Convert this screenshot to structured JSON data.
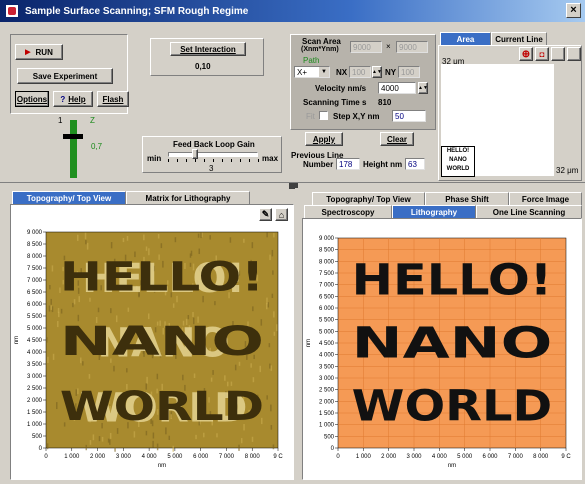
{
  "window": {
    "title": "Sample Surface Scanning; SFM Rough Regime",
    "close_label": "×"
  },
  "controls": {
    "run_label": "RUN",
    "save_label": "Save Experiment",
    "options_label": "Options",
    "help_label": "Help",
    "flash_label": "Flash",
    "scale_top": "1",
    "scale_z": "Z",
    "scale_value": "0,7"
  },
  "interaction": {
    "set_label": "Set Interaction",
    "value": "0,10"
  },
  "feedback": {
    "title": "Feed Back Loop Gain",
    "min_label": "min",
    "max_label": "max",
    "value": "3",
    "level_fraction": 0.3
  },
  "scan": {
    "area_label_1": "Scan Area",
    "area_label_2": "(Xnm*Ynm)",
    "x_area": "9000",
    "times": "×",
    "y_area": "9000",
    "path_label": "Path",
    "path_value": "X+",
    "nx_label": "NX",
    "nx_value": "100",
    "ny_label": "NY",
    "ny_value": "100",
    "velocity_label": "Velocity nm/s",
    "velocity_value": "4000",
    "scanning_time_label": "Scanning Time s",
    "scanning_time_value": "810",
    "fit_label": "Fit",
    "step_label": "Step X,Y  nm",
    "step_value": "50",
    "apply_label": "Apply",
    "clear_label": "Clear",
    "prev_line_label": "Previous Line",
    "number_label": "Number",
    "number_value": "178",
    "height_label": "Height nm",
    "height_value": "63"
  },
  "area_view": {
    "tabs": [
      "Area",
      "Current Line"
    ],
    "active_tab": 0,
    "top_label": "32 μm",
    "bottom_label": "32 μm",
    "thumb_lines": [
      "HELLO!",
      "NANO",
      "WORLD"
    ]
  },
  "left_view": {
    "tabs": [
      "Topography/ Top View",
      "Matrix for Lithography"
    ],
    "active_tab": 0,
    "image_lines": [
      "HELLO!",
      "NANO",
      "WORLD"
    ],
    "y_ticks": [
      "9 000",
      "8 500",
      "8 000",
      "7 500",
      "7 000",
      "6 500",
      "6 000",
      "5 500",
      "5 000",
      "4 500",
      "4 000",
      "3 500",
      "3 000",
      "2 500",
      "2 000",
      "1 500",
      "1 000",
      "500",
      "0"
    ],
    "x_ticks": [
      "0",
      "1 000",
      "2 000",
      "3 000",
      "4 000",
      "5 000",
      "6 000",
      "7 000",
      "8 000",
      "9 C"
    ],
    "ylabel": "nm",
    "xlabel": "nm"
  },
  "right_view": {
    "tabs_row1": [
      "Topography/ Top View",
      "Phase Shift",
      "Force Image"
    ],
    "tabs_row2": [
      "Spectroscopy",
      "Lithography",
      "One Line Scanning"
    ],
    "active_tab": "Lithography",
    "image_lines": [
      "HELLO!",
      "NANO",
      "WORLD"
    ],
    "y_ticks": [
      "9 000",
      "8 500",
      "8 000",
      "7 500",
      "7 000",
      "6 500",
      "6 000",
      "5 500",
      "5 000",
      "4 500",
      "4 000",
      "3 500",
      "3 000",
      "2 500",
      "2 000",
      "1 500",
      "1 000",
      "500",
      "0"
    ],
    "x_ticks": [
      "0",
      "1 000",
      "2 000",
      "3 000",
      "4 000",
      "5 000",
      "6 000",
      "7 000",
      "8 000",
      "9 C"
    ],
    "ylabel": "nm",
    "xlabel": "nm"
  },
  "colors": {
    "title_blue": "#0a246a",
    "tab_active": "#3a6ec5",
    "field_blue": "#000080",
    "green": "#2ea02e",
    "topo_fill": "#a88a2e",
    "litho_fill": "#f59a55",
    "run_red": "#c00000"
  }
}
